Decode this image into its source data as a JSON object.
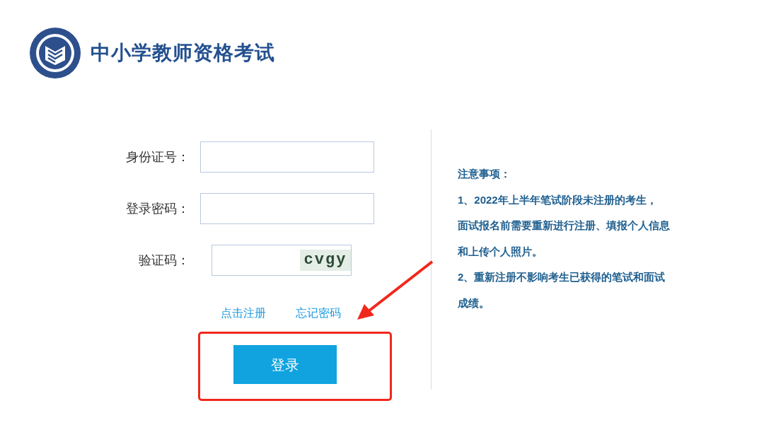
{
  "header": {
    "title": "中小学教师资格考试"
  },
  "form": {
    "fields": [
      {
        "kind": "text",
        "label": "身份证号："
      },
      {
        "kind": "password",
        "label": "登录密码："
      },
      {
        "kind": "captcha",
        "label": "验证码：",
        "captcha": "cvgy"
      }
    ],
    "links": [
      "点击注册",
      "忘记密码"
    ],
    "submit": "登录"
  },
  "notice": {
    "title": "注意事项：",
    "lines": [
      "1、2022年上半年笔试阶段未注册的考生，",
      "面试报名前需要重新进行注册、填报个人信息",
      "和上传个人照片。",
      "2、重新注册不影响考生已获得的笔试和面试",
      "成绩。"
    ]
  }
}
